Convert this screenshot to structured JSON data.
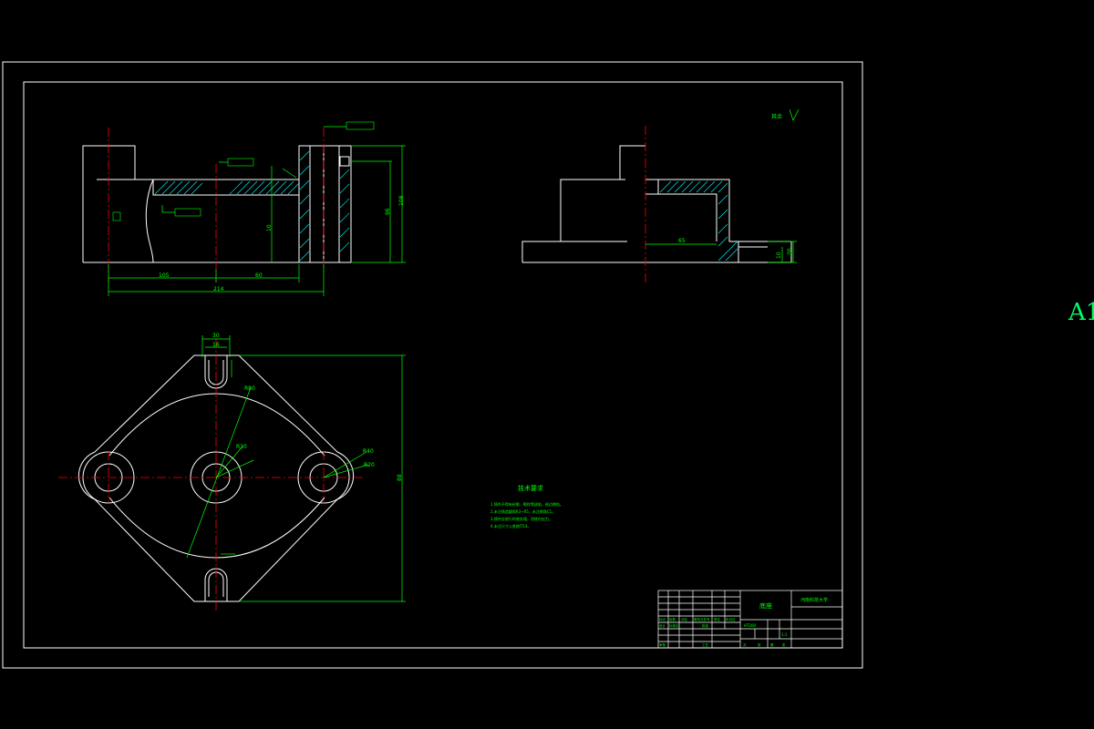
{
  "sheet": {
    "size_label": "A1"
  },
  "colors": {
    "background": "#000000",
    "outline": "#ffffff",
    "dimension": "#00ff00",
    "centerline": "#ff0000",
    "hatch": "#00ffff"
  },
  "dimensions": {
    "front_view": {
      "len_a": "105",
      "len_b": "60",
      "len_total": "214",
      "height": "108",
      "height_b": "96",
      "height_c": "10"
    },
    "plan_view": {
      "width_top": "30",
      "slot": "16",
      "height": "88",
      "radius_a": "R80",
      "radius_b": "R30",
      "radius_c": "R40",
      "radius_d": "R20"
    },
    "side_view": {
      "len": "65",
      "h1": "10",
      "h2": "20"
    }
  },
  "notes": {
    "title": "技术要求",
    "lines": [
      "1.铸件不得有砂眼、裂纹等缺陷，锐边倒钝。",
      "2.未注铸造圆角R3~R5，未注倒角C1。",
      "3.铸件应进行时效处理，消除内应力。",
      "4.未注尺寸公差按IT14。"
    ]
  },
  "surface_note": {
    "text": "其余"
  },
  "title_block": {
    "part_name": "底座",
    "school": "河南科技大学",
    "scale": "1:1",
    "material": "HT200",
    "row_labels": [
      "标记",
      "处数",
      "分区",
      "更改文件号",
      "签名",
      "年月日"
    ],
    "row_labels_b": [
      "设计",
      "标准化",
      "审核",
      "工艺",
      "批准"
    ],
    "footer": [
      "共",
      "张",
      "第",
      "张"
    ]
  }
}
